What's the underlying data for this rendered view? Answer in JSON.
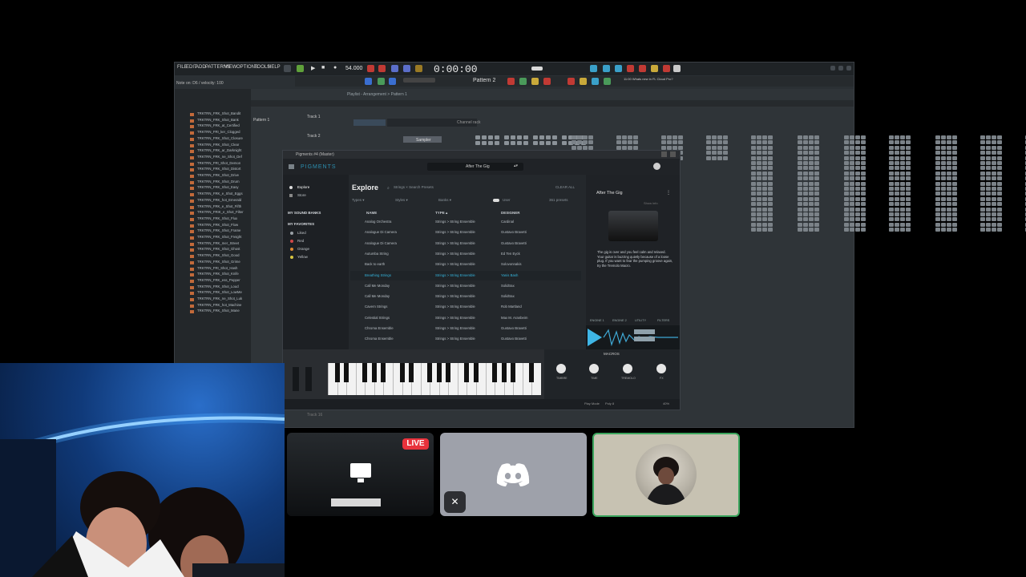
{
  "fl_studio": {
    "menu": [
      "FILE",
      "EDIT",
      "ADD",
      "PATTERNS",
      "VIEW",
      "OPTIONS",
      "TOOLS",
      "HELP"
    ],
    "hint": "Note on: D6 / velocity: 100",
    "time": "0:00:00",
    "bpm": "54.000",
    "pattern": "Pattern 2",
    "playlist_title": "Playlist - Arrangement > Pattern 1",
    "tracks": [
      "Track 1",
      "Track 2"
    ],
    "pattern_label": "Pattern 1",
    "hint_panel": "11:00 Whats new in FL Cloud Pro?",
    "channel_rack": "Channel rack",
    "sampler": "Sampler",
    "track_16": "Track 16",
    "browser_items": [
      "TRKTRN_FRK_Shot_Bandit",
      "TRKTRN_FRK_Shot_Bank",
      "TRKTRN_FRK_at_Certified",
      "TRKTRN_FRI_ker_Clogged",
      "TRKTRN_FRK_Shot_Closure",
      "TRKTRN_FRK_Shot_Clear",
      "TRKTRN_FRK_ar_Darknight",
      "TRKTRN_FRK_ne_Shot_Def",
      "TRKTRN_FRI_Shot_Demon",
      "TRKTRN_FRK_Shot_Distort",
      "TRKTRN_FRK_Shot_Drive",
      "TRKTRN_FRK_Shot_Drum",
      "TRKTRN_FRK_Shot_Easy",
      "TRKTRN_FRK_e_Shot_Eggs",
      "TRKTRN_FRK_hot_Emerald",
      "TRKTRN_FRK_e_Shot_Fifth",
      "TRKTRN_FRIK_e_Shot_Filter",
      "TRKTRN_FRK_Shot_Flux",
      "TRKTRN_FRK_Shot_Flow",
      "TRKTRN_FRK_Shot_Frame",
      "TRKTRN_FRK_Shot_Freight",
      "TRKTRN_FRK_mer_Street",
      "TRKTRN_FRK_Shot_Ghost",
      "TRKTRN_FRK_Shot_Good",
      "TRKTRN_FRK_Shot_Grime",
      "TRKTRN_FRI_Shot_Hash",
      "TRKTRN_FRK_Shot_Knife",
      "TRKTRN_FRK_ess_Pepper",
      "TRKTRN_FRK_Shot_Loud",
      "TRKTRN_FRK_Shot_LowMe",
      "TRKTRN_FRK_ne_Shot_Luk",
      "TRKTRN_FRK_hot_Machine",
      "TRKTRN_FRK_Shot_Mane"
    ]
  },
  "pigments": {
    "window_title": "Pigments #4 (Master)",
    "logo": "PIGMENTS",
    "current_preset": "After The Gig",
    "sidebar": {
      "explore": "Explore",
      "store": "Store",
      "my_sound_banks": "MY SOUND BANKS",
      "my_favorites": "MY FAVORITES",
      "favorites": [
        {
          "name": "Liked",
          "color": "#9aa0a6"
        },
        {
          "name": "Red",
          "color": "#d04848"
        },
        {
          "name": "Orange",
          "color": "#e08a34"
        },
        {
          "name": "Yellow",
          "color": "#d8c640"
        }
      ]
    },
    "explore": {
      "title": "Explore",
      "search": "Strings ×   Search Presets",
      "clear_all": "CLEAR ALL",
      "filters": [
        "Types ▾",
        "Styles ▾",
        "Banks ▾",
        "User",
        "361 presets"
      ],
      "columns": [
        "NAME",
        "TYPE ▴",
        "DESIGNER"
      ],
      "rows": [
        {
          "name": "Analog Orchestra",
          "type": "Strings > String Ensemble",
          "designer": "Cardinal"
        },
        {
          "name": "Analogue Di Camera",
          "type": "Strings > String Ensemble",
          "designer": "Gustavo Bravetti"
        },
        {
          "name": "Analogue Di Camera",
          "type": "Strings > String Ensemble",
          "designer": "Gustavo Bravetti"
        },
        {
          "name": "Autumba String",
          "type": "Strings > String Ensemble",
          "designer": "Ed Ten Eyck"
        },
        {
          "name": "Back to earth",
          "type": "Strings > String Ensemble",
          "designer": "Solovonnakis"
        },
        {
          "name": "Breathing Strings",
          "type": "Strings > String Ensemble",
          "designer": "Yanis Bash"
        },
        {
          "name": "Call Me Monday",
          "type": "Strings > String Ensemble",
          "designer": "Solidtrax"
        },
        {
          "name": "Call Me Monday",
          "type": "Strings > String Ensemble",
          "designer": "Solidtrax"
        },
        {
          "name": "Cavern Strings",
          "type": "Strings > String Ensemble",
          "designer": "Rob Martland"
        },
        {
          "name": "Celestial Strings",
          "type": "Strings > String Ensemble",
          "designer": "Max M. Aranbeim"
        },
        {
          "name": "Chroma Ensemble",
          "type": "Strings > String Ensemble",
          "designer": "Gustavo Bravetti"
        },
        {
          "name": "Chroma Ensemble",
          "type": "Strings > String Ensemble",
          "designer": "Gustavo Bravetti"
        }
      ]
    },
    "right_panel": {
      "name": "After The Gig",
      "designer_tag": "Show info",
      "description": "The gig is over and you feel calm and relaxed. Your guitar is buzzing quietly because of a loose plug. If you want to fear the pumping groove again, try the Tremolo Macro."
    },
    "engines": [
      "ENGINE 1",
      "ENGINE 2",
      "UTILITY",
      "FILTERS"
    ],
    "macros": {
      "title": "MACROS",
      "knobs": [
        "TIMBRE",
        "TIME",
        "TREMOLO",
        "FX"
      ]
    },
    "status": {
      "play_mode": "Play Mode",
      "poly": "Poly 8",
      "cpu": "40%"
    }
  },
  "call": {
    "live_badge": "LIVE"
  }
}
